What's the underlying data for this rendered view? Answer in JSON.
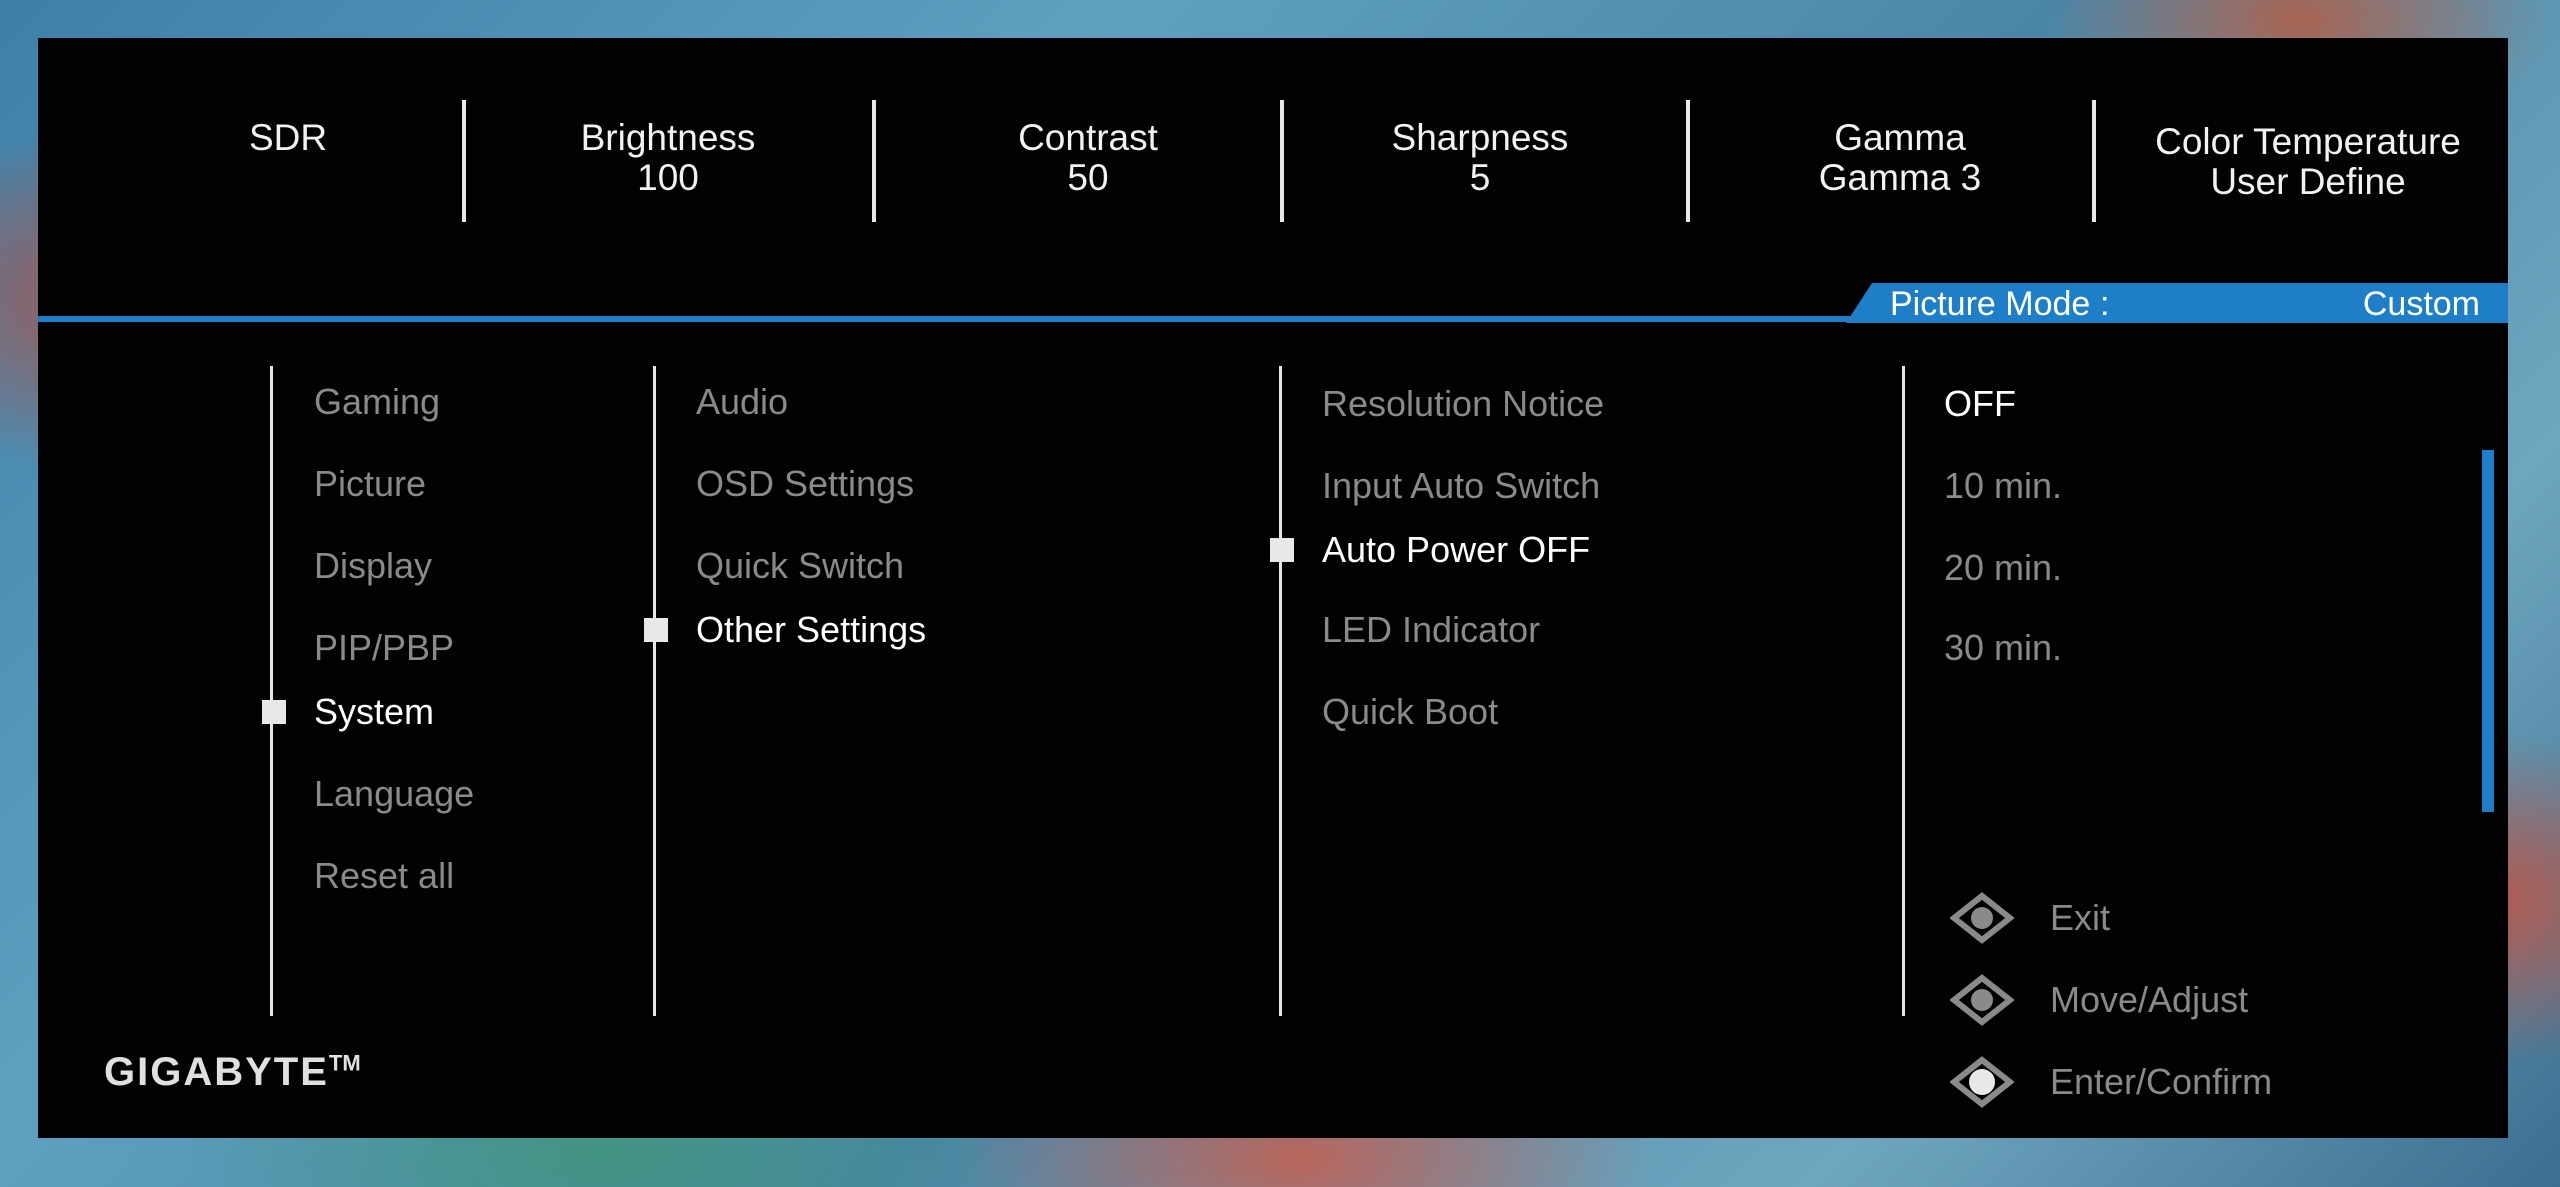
{
  "osd": {
    "params": [
      {
        "label": "SDR",
        "value": ""
      },
      {
        "label": "Brightness",
        "value": "100"
      },
      {
        "label": "Contrast",
        "value": "50"
      },
      {
        "label": "Sharpness",
        "value": "5"
      },
      {
        "label": "Gamma",
        "value": "Gamma 3"
      },
      {
        "label": "Color Temperature",
        "value": "User Define"
      }
    ],
    "picture_mode": {
      "label": "Picture Mode",
      "colon": ":",
      "value": "Custom"
    },
    "menu": {
      "main": [
        "Gaming",
        "Picture",
        "Display",
        "PIP/PBP",
        "System",
        "Language",
        "Reset all"
      ],
      "system": [
        "Audio",
        "OSD Settings",
        "Quick Switch",
        "Other Settings"
      ],
      "other": [
        "Resolution Notice",
        "Input Auto Switch",
        "Auto Power OFF",
        "LED Indicator",
        "Quick Boot"
      ],
      "options": [
        "OFF",
        "10 min.",
        "20 min.",
        "30 min."
      ]
    },
    "selected": {
      "main": "System",
      "system": "Other Settings",
      "other": "Auto Power OFF",
      "option": "OFF"
    },
    "help": [
      {
        "icon": "joystick-exit-icon",
        "label": "Exit"
      },
      {
        "icon": "joystick-move-icon",
        "label": "Move/Adjust"
      },
      {
        "icon": "joystick-enter-icon",
        "label": "Enter/Confirm"
      }
    ],
    "brand": {
      "name": "GIGABYTE",
      "mark": "TM"
    },
    "colors": {
      "accent": "#1e7fc8",
      "panel": "#020203",
      "selected_text": "#ffffff",
      "dim_text": "#8a8a8a"
    }
  }
}
